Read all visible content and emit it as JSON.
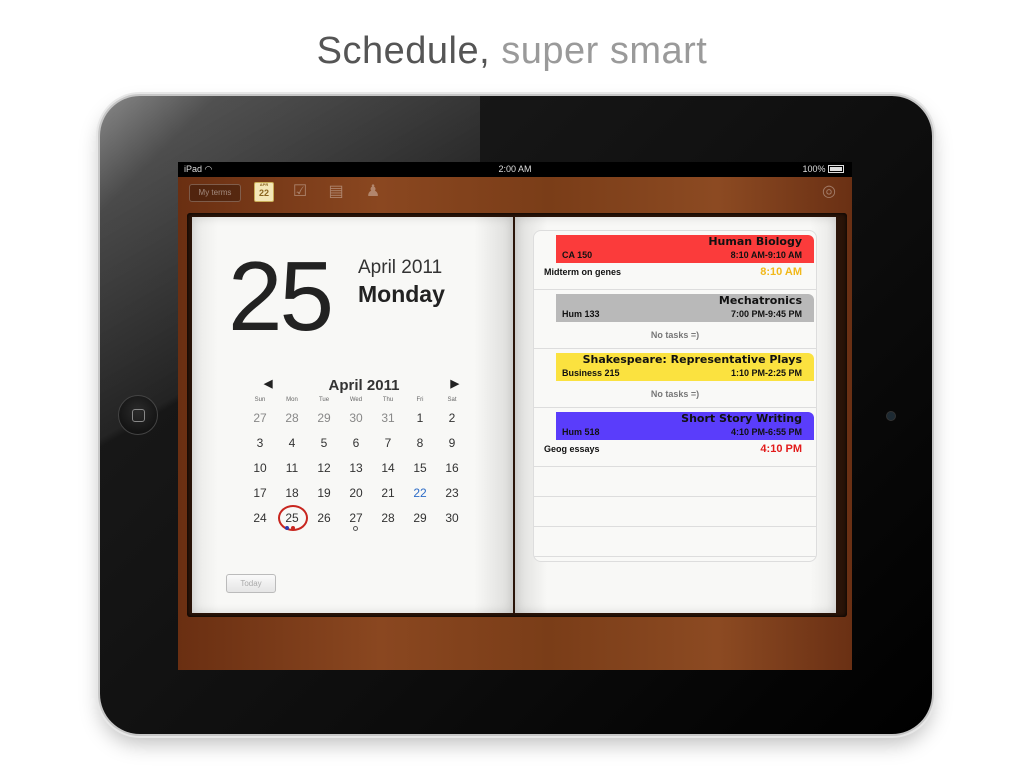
{
  "headline": {
    "bold": "Schedule,",
    "light": "super smart"
  },
  "status": {
    "carrier": "iPad",
    "time": "2:00 AM",
    "battery": "100%"
  },
  "toolbar": {
    "terms_label": "My terms",
    "cal_icon_month": "APR",
    "cal_icon_day": "22"
  },
  "day_view": {
    "day": "25",
    "month_year": "April 2011",
    "weekday": "Monday"
  },
  "mini_calendar": {
    "title": "April 2011",
    "prev": "◀",
    "next": "▶",
    "dow": [
      "Sun",
      "Mon",
      "Tue",
      "Wed",
      "Thu",
      "Fri",
      "Sat"
    ],
    "weeks": [
      [
        "27",
        "28",
        "29",
        "30",
        "31",
        "1",
        "2"
      ],
      [
        "3",
        "4",
        "5",
        "6",
        "7",
        "8",
        "9"
      ],
      [
        "10",
        "11",
        "12",
        "13",
        "14",
        "15",
        "16"
      ],
      [
        "17",
        "18",
        "19",
        "20",
        "21",
        "22",
        "23"
      ],
      [
        "24",
        "25",
        "26",
        "27",
        "28",
        "29",
        "30"
      ]
    ],
    "today_label": "Today"
  },
  "events": [
    {
      "title": "Human Biology",
      "code": "CA 150",
      "time": "8:10 AM-9:10 AM",
      "color": "#fb3b3b",
      "task": "Midterm on genes",
      "due": "8:10 AM",
      "due_color": "#f1b81a"
    },
    {
      "title": "Mechatronics",
      "code": "Hum 133",
      "time": "7:00 PM-9:45 PM",
      "color": "#b9b9b9",
      "none": "No tasks =)"
    },
    {
      "title": "Shakespeare: Representative Plays",
      "code": "Business 215",
      "time": "1:10 PM-2:25 PM",
      "color": "#fbe23f",
      "none": "No tasks =)"
    },
    {
      "title": "Short Story Writing",
      "code": "Hum 518",
      "time": "4:10 PM-6:55 PM",
      "color": "#5a3dfb",
      "task": "Geog essays",
      "due": "4:10 PM",
      "due_color": "#e21b1b"
    }
  ]
}
